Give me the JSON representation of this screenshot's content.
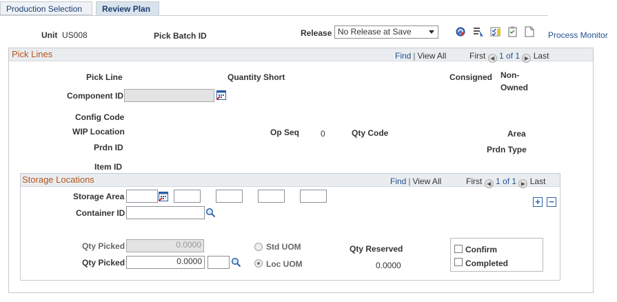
{
  "tabs": [
    {
      "label": "Production Selection"
    },
    {
      "label": "Review Plan"
    }
  ],
  "header": {
    "unit_label": "Unit",
    "unit_value": "US008",
    "pick_batch_label": "Pick Batch ID",
    "release_label": "Release",
    "release_value": "No Release at Save",
    "process_monitor": "Process Monitor",
    "icons": [
      "refresh-icon",
      "select-icon",
      "checklist-icon",
      "notepad-icon",
      "document-icon"
    ]
  },
  "pick_lines": {
    "title": "Pick Lines",
    "find": "Find",
    "view_all": "View All",
    "first": "First",
    "counter": "1 of 1",
    "last": "Last",
    "labels": {
      "pick_line": "Pick Line",
      "quantity_short": "Quantity Short",
      "consigned": "Consigned",
      "non_owned_1": "Non-",
      "non_owned_2": "Owned",
      "component_id": "Component ID",
      "config_code": "Config Code",
      "wip_location": "WIP Location",
      "op_seq": "Op Seq",
      "op_seq_value": "0",
      "qty_code": "Qty Code",
      "area": "Area",
      "prdn_id": "Prdn ID",
      "prdn_type": "Prdn Type",
      "item_id": "Item ID"
    }
  },
  "storage": {
    "title": "Storage Locations",
    "find": "Find",
    "view_all": "View All",
    "first": "First",
    "counter": "1 of 1",
    "last": "Last",
    "storage_area_label": "Storage Area",
    "container_id_label": "Container ID",
    "qty_picked_label": "Qty Picked",
    "qty_picked_std_value": "0.0000",
    "qty_picked_loc_value": "0.0000",
    "std_uom_label": "Std UOM",
    "loc_uom_label": "Loc UOM",
    "qty_reserved_label": "Qty Reserved",
    "qty_reserved_value": "0.0000",
    "confirm_label": "Confirm",
    "completed_label": "Completed",
    "add_symbol": "+",
    "remove_symbol": "−"
  }
}
